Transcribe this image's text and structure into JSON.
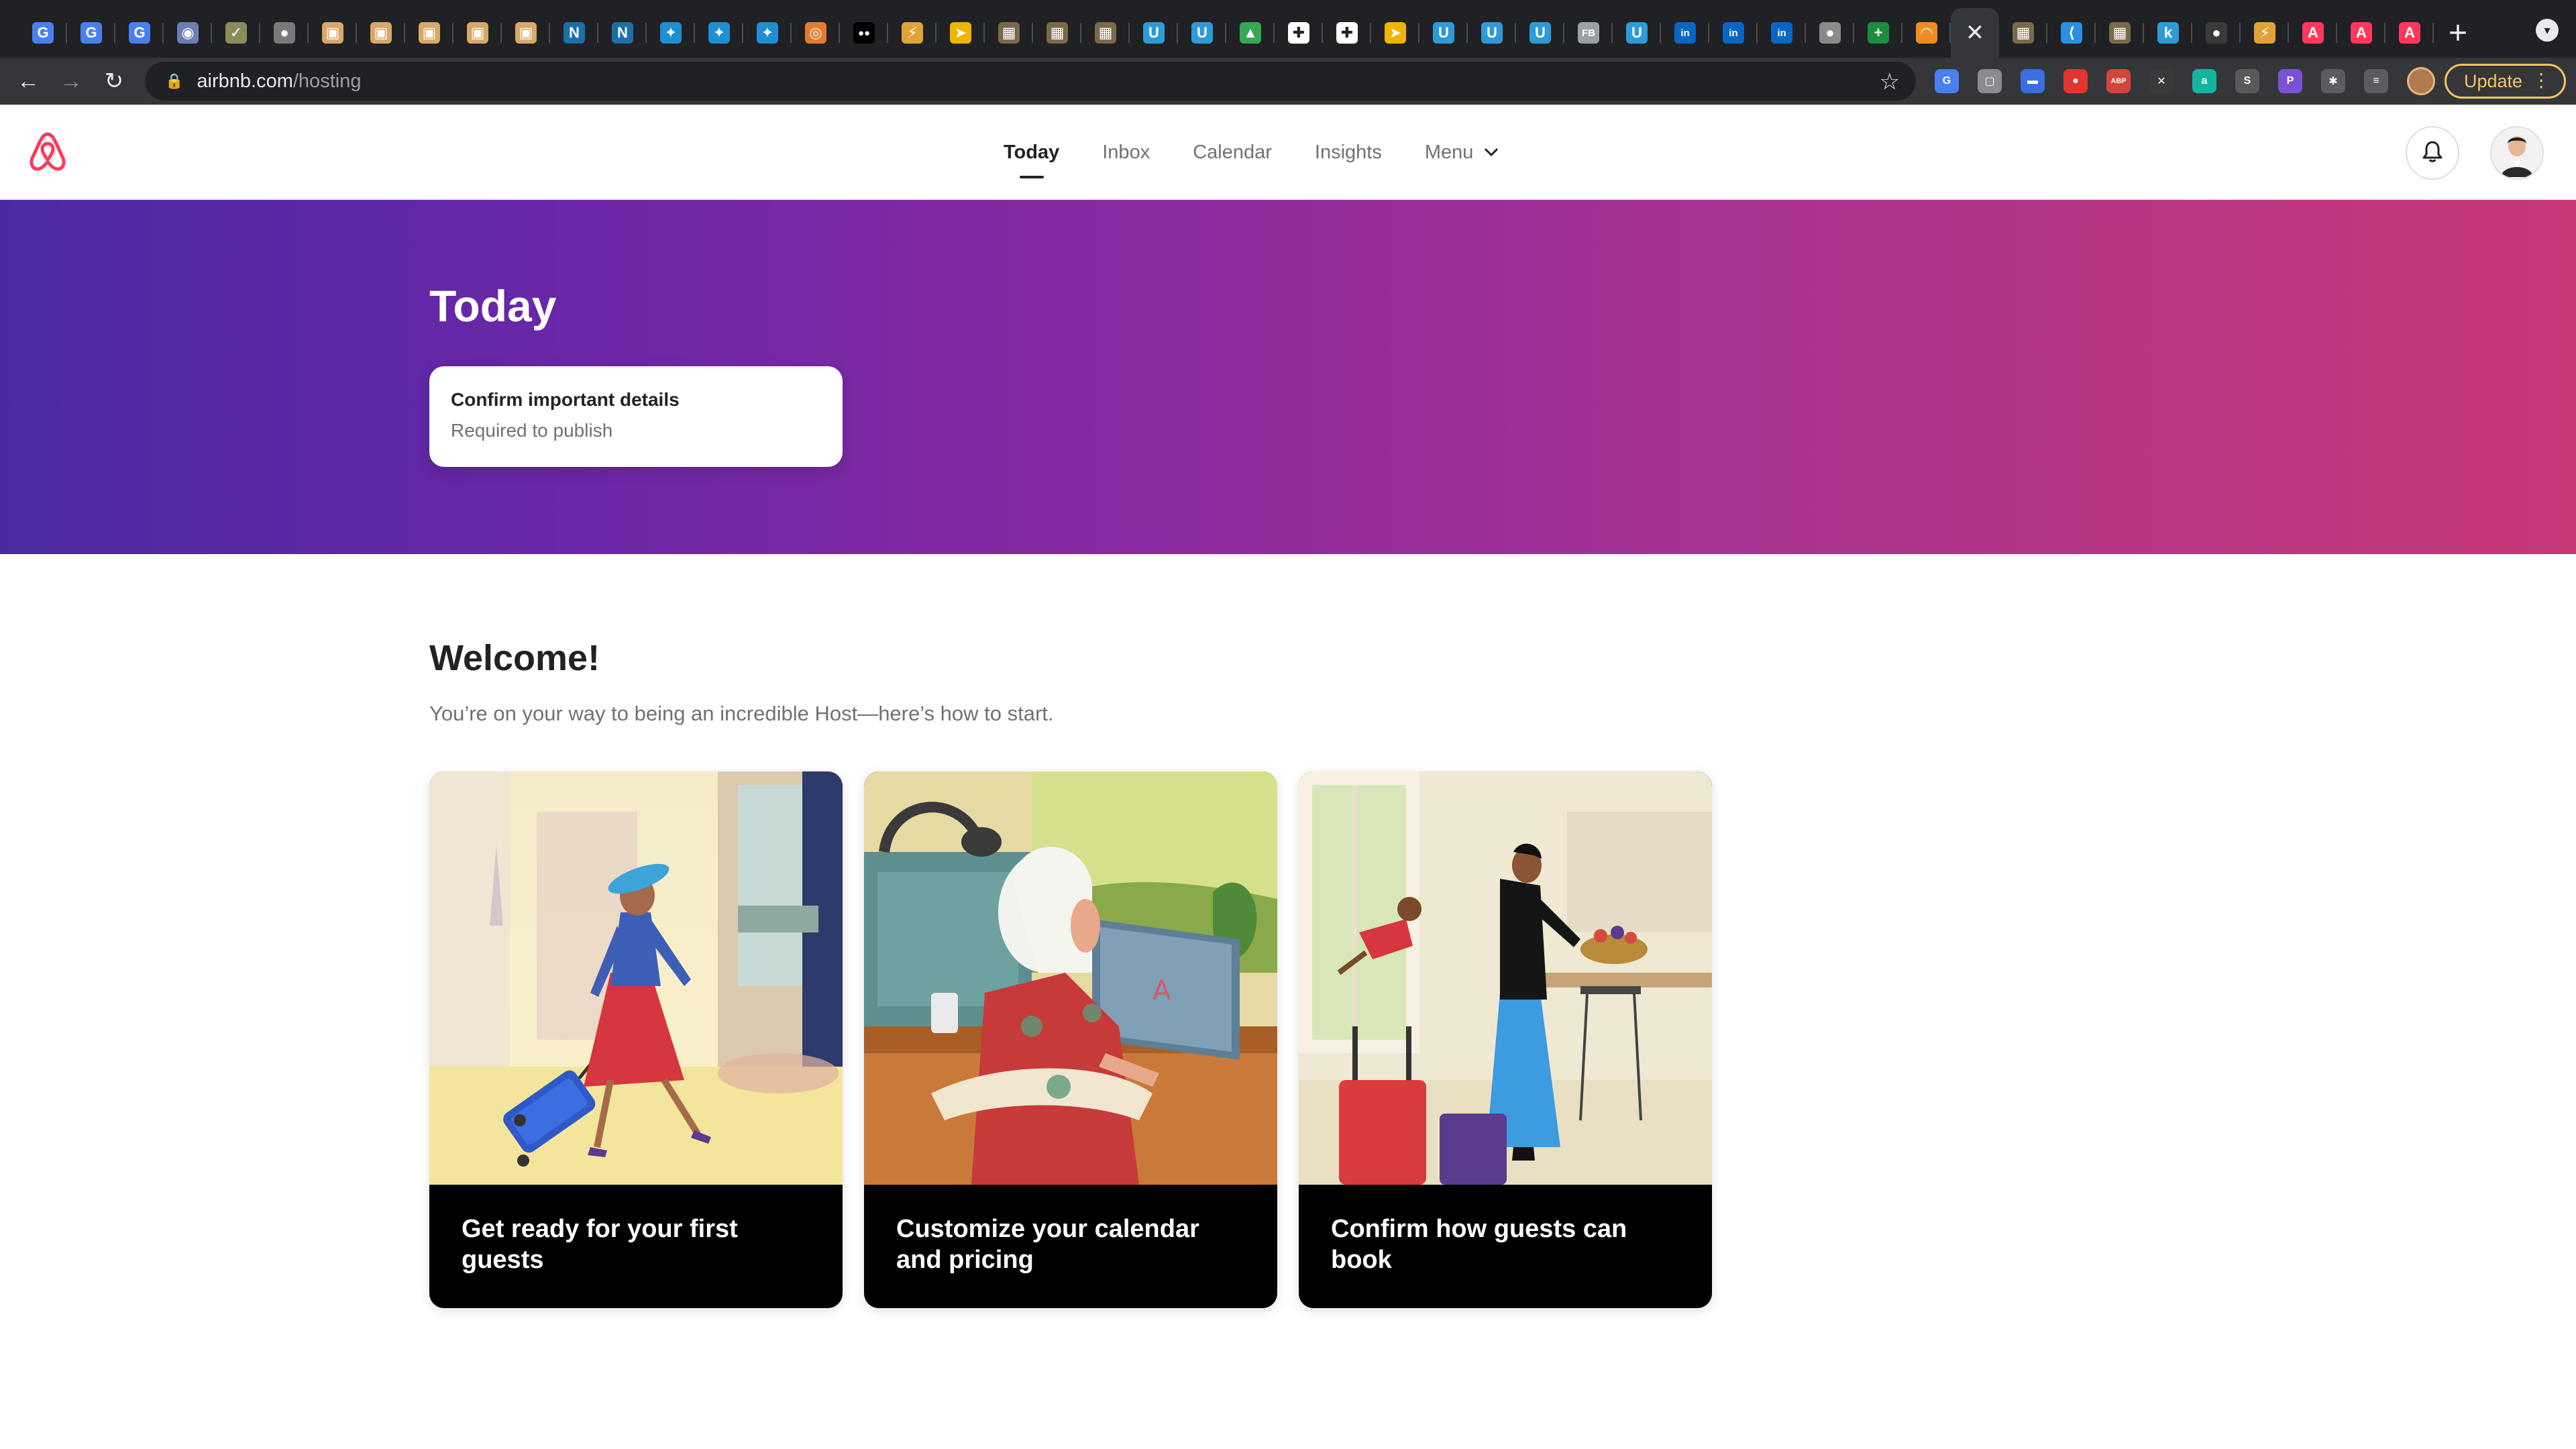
{
  "browser": {
    "tabs": [
      {
        "icon": "google-translate-icon",
        "glyph": "G",
        "color": "#4a7ff0"
      },
      {
        "icon": "google-translate-icon",
        "glyph": "G",
        "color": "#4a7ff0"
      },
      {
        "icon": "google-translate-icon",
        "glyph": "G",
        "color": "#4a7ff0"
      },
      {
        "icon": "app-icon",
        "glyph": "◉",
        "color": "#6b7fb5"
      },
      {
        "icon": "chart-icon",
        "glyph": "✓",
        "color": "#8c8c5a"
      },
      {
        "icon": "globe-icon",
        "glyph": "●",
        "color": "#7a7a7a"
      },
      {
        "icon": "image-icon",
        "glyph": "▣",
        "color": "#d8a866"
      },
      {
        "icon": "image-icon",
        "glyph": "▣",
        "color": "#d8a866"
      },
      {
        "icon": "image-icon",
        "glyph": "▣",
        "color": "#d8a866"
      },
      {
        "icon": "image-icon",
        "glyph": "▣",
        "color": "#d8a866"
      },
      {
        "icon": "image-icon",
        "glyph": "▣",
        "color": "#d8a866"
      },
      {
        "icon": "n-logo-icon",
        "glyph": "N",
        "color": "#1b6fa8"
      },
      {
        "icon": "n-logo-icon",
        "glyph": "N",
        "color": "#1b6fa8"
      },
      {
        "icon": "bird-icon",
        "glyph": "✦",
        "color": "#1f8fd1"
      },
      {
        "icon": "bird-icon",
        "glyph": "✦",
        "color": "#1f8fd1"
      },
      {
        "icon": "bird-icon",
        "glyph": "✦",
        "color": "#1f8fd1"
      },
      {
        "icon": "search-circle-icon",
        "glyph": "◎",
        "color": "#e57b2e"
      },
      {
        "icon": "medium-icon",
        "glyph": "●●",
        "color": "#000000"
      },
      {
        "icon": "bolt-icon",
        "glyph": "⚡",
        "color": "#e0a33a"
      },
      {
        "icon": "arrow-icon",
        "glyph": "➤",
        "color": "#f0b400"
      },
      {
        "icon": "photo-icon",
        "glyph": "▦",
        "color": "#7a6a4a"
      },
      {
        "icon": "photo-icon",
        "glyph": "▦",
        "color": "#7a6a4a"
      },
      {
        "icon": "photo-icon",
        "glyph": "▦",
        "color": "#7a6a4a"
      },
      {
        "icon": "u-logo-icon",
        "glyph": "U",
        "color": "#2d9bd8"
      },
      {
        "icon": "u-logo-icon",
        "glyph": "U",
        "color": "#2d9bd8"
      },
      {
        "icon": "google-drive-icon",
        "glyph": "▲",
        "color": "#34a853"
      },
      {
        "icon": "cross-icon",
        "glyph": "✚",
        "color": "#ffffff"
      },
      {
        "icon": "cross-icon",
        "glyph": "✚",
        "color": "#ffffff"
      },
      {
        "icon": "arrow-icon",
        "glyph": "➤",
        "color": "#f0b400"
      },
      {
        "icon": "u-logo-icon",
        "glyph": "U",
        "color": "#2d9bd8"
      },
      {
        "icon": "u-logo-icon",
        "glyph": "U",
        "color": "#2d9bd8"
      },
      {
        "icon": "u-logo-icon",
        "glyph": "U",
        "color": "#2d9bd8"
      },
      {
        "icon": "fb-text-icon",
        "glyph": "FB",
        "color": "#9aa0a6"
      },
      {
        "icon": "u-logo-icon",
        "glyph": "U",
        "color": "#2d9bd8"
      },
      {
        "icon": "linkedin-icon",
        "glyph": "in",
        "color": "#0a66c2"
      },
      {
        "icon": "linkedin-icon",
        "glyph": "in",
        "color": "#0a66c2"
      },
      {
        "icon": "linkedin-icon",
        "glyph": "in",
        "color": "#0a66c2"
      },
      {
        "icon": "apple-icon",
        "glyph": "●",
        "color": "#8a8a8a"
      },
      {
        "icon": "sheets-plus-icon",
        "glyph": "+",
        "color": "#1e8e3e"
      },
      {
        "icon": "amazon-icon",
        "glyph": "◠",
        "color": "#f08c24"
      },
      {
        "icon": "close-icon",
        "glyph": "✕",
        "color": "#e8eaed",
        "active": true
      },
      {
        "icon": "photo-icon",
        "glyph": "▦",
        "color": "#7a6a4a"
      },
      {
        "icon": "vscode-icon",
        "glyph": "⟨",
        "color": "#2c8fe0"
      },
      {
        "icon": "photo-icon",
        "glyph": "▦",
        "color": "#7a6a4a"
      },
      {
        "icon": "k-logo-icon",
        "glyph": "k",
        "color": "#2d9bd8"
      },
      {
        "icon": "github-icon",
        "glyph": "●",
        "color": "#3a3a3a"
      },
      {
        "icon": "bolt-icon",
        "glyph": "⚡",
        "color": "#e0a33a"
      },
      {
        "icon": "airbnb-icon",
        "glyph": "A",
        "color": "#ff385c"
      },
      {
        "icon": "airbnb-icon",
        "glyph": "A",
        "color": "#ff385c"
      },
      {
        "icon": "airbnb-icon",
        "glyph": "A",
        "color": "#ff385c"
      }
    ],
    "new_tab_glyph": "+",
    "tab_search_glyph": "▾",
    "back_glyph": "←",
    "forward_glyph": "→",
    "reload_glyph": "↻",
    "lock_glyph": "🔒",
    "url_domain": "airbnb.com",
    "url_path": "/hosting",
    "bookmark_glyph": "☆",
    "extensions": [
      {
        "icon": "translate-ext-icon",
        "glyph": "G",
        "color": "#4a7ff0"
      },
      {
        "icon": "screen-ext-icon",
        "glyph": "▢",
        "color": "#8a8c90"
      },
      {
        "icon": "window-ext-icon",
        "glyph": "▬",
        "color": "#3b6fe0"
      },
      {
        "icon": "ghost-ext-icon",
        "glyph": "●",
        "color": "#e3342f"
      },
      {
        "icon": "adblock-ext-icon",
        "glyph": "ABP",
        "color": "#d0463a"
      },
      {
        "icon": "x-ext-icon",
        "glyph": "✕",
        "color": "#3a3a3a"
      },
      {
        "icon": "grammar-ext-icon",
        "glyph": "a",
        "color": "#15b4a0"
      },
      {
        "icon": "sb-ext-icon",
        "glyph": "S",
        "color": "#5a5a5a"
      },
      {
        "icon": "p-ext-icon",
        "glyph": "P",
        "color": "#7b52d6"
      },
      {
        "icon": "puzzle-ext-icon",
        "glyph": "✱",
        "color": "#5a5c60"
      },
      {
        "icon": "media-ext-icon",
        "glyph": "≡",
        "color": "#5a5c60"
      }
    ],
    "update_label": "Update",
    "menu_glyph": "⋮"
  },
  "site": {
    "nav": [
      {
        "label": "Today",
        "active": true
      },
      {
        "label": "Inbox"
      },
      {
        "label": "Calendar"
      },
      {
        "label": "Insights"
      },
      {
        "label": "Menu",
        "dropdown": true
      }
    ],
    "menu_chevron": "⌄"
  },
  "hero": {
    "title": "Today",
    "card_title": "Confirm important details",
    "card_subtitle": "Required to publish"
  },
  "welcome": {
    "title": "Welcome!",
    "subtitle": "You’re on your way to being an incredible Host—here’s how to start.",
    "cards": [
      {
        "caption": "Get ready for your first guests"
      },
      {
        "caption": "Customize your calendar and pricing"
      },
      {
        "caption": "Confirm how guests can book"
      }
    ]
  },
  "colors": {
    "brand": "#ff385c",
    "hero_start": "#4a2aa3",
    "hero_end": "#c73876",
    "update_accent": "#f6c564"
  }
}
